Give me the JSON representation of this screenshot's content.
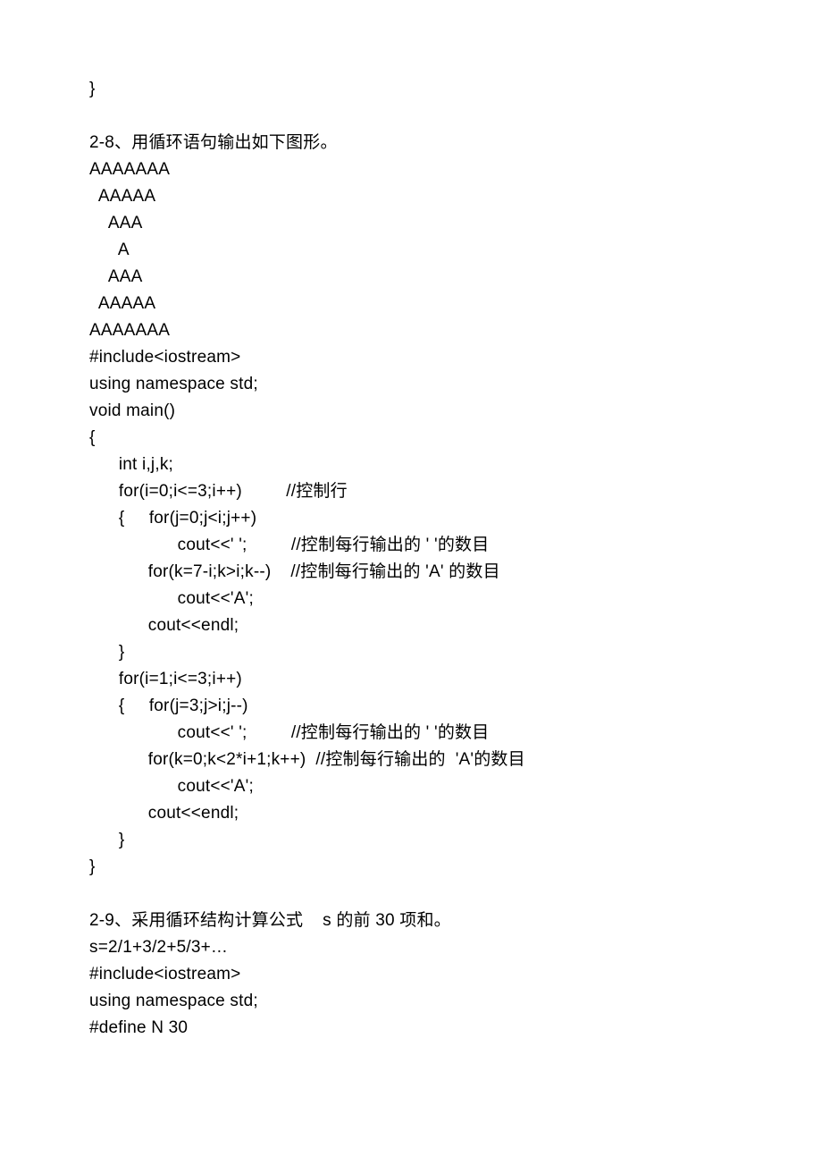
{
  "lines": [
    "}",
    "",
    "2-8、用循环语句输出如下图形。",
    "AAAAAAA",
    "  AAAAA",
    "    AAA",
    "      A",
    "    AAA",
    "  AAAAA",
    "AAAAAAA",
    "#include<iostream>",
    "using namespace std;",
    "void main()",
    "{",
    "      int i,j,k;",
    "      for(i=0;i<=3;i++)         //控制行",
    "      {     for(j=0;j<i;j++)",
    "                  cout<<' ';         //控制每行输出的 ' '的数目",
    "            for(k=7-i;k>i;k--)    //控制每行输出的 'A' 的数目",
    "                  cout<<'A';",
    "            cout<<endl;",
    "      }",
    "      for(i=1;i<=3;i++)",
    "      {     for(j=3;j>i;j--)",
    "                  cout<<' ';         //控制每行输出的 ' '的数目",
    "            for(k=0;k<2*i+1;k++)  //控制每行输出的  'A'的数目",
    "                  cout<<'A';",
    "            cout<<endl;",
    "      }",
    "}",
    "",
    "2-9、采用循环结构计算公式    s 的前 30 项和。",
    "s=2/1+3/2+5/3+…",
    "#include<iostream>",
    "using namespace std;",
    "#define N 30"
  ]
}
